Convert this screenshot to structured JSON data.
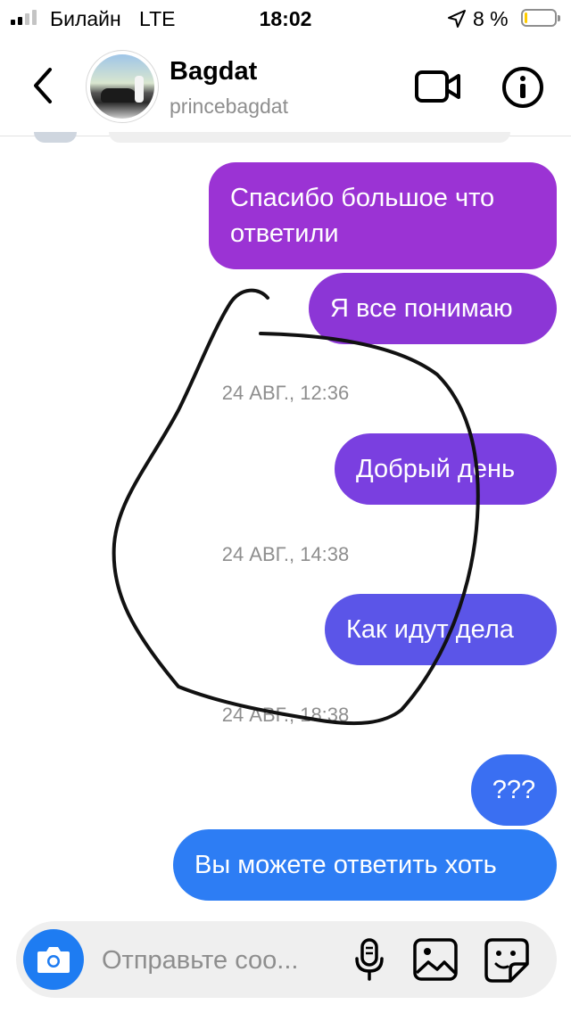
{
  "status_bar": {
    "carrier": "Билайн",
    "network": "LTE",
    "time": "18:02",
    "battery_percent": "8 %",
    "battery_level": 0.08,
    "battery_color": "#ffcc00",
    "signal_bars_active": 2,
    "icons": [
      "signal-icon",
      "location-arrow-icon",
      "battery-icon"
    ]
  },
  "header": {
    "name": "Bagdat",
    "username": "princebagdat",
    "icons": [
      "back-chevron-icon",
      "video-camera-icon",
      "info-icon"
    ]
  },
  "messages": [
    {
      "type": "sent",
      "text_lines": [
        "Спасибо большое что",
        "ответили"
      ],
      "color": "#9b33d4"
    },
    {
      "type": "sent",
      "text": "Я все понимаю",
      "color": "#8c36d6"
    },
    {
      "type": "timestamp",
      "text": "24 АВГ., 12:36"
    },
    {
      "type": "sent",
      "text": "Добрый день",
      "color": "#7a3fe0"
    },
    {
      "type": "timestamp",
      "text": "24 АВГ., 14:38"
    },
    {
      "type": "sent",
      "text": "Как идут дела",
      "color": "#5b55e8"
    },
    {
      "type": "timestamp",
      "text": "24 АВГ., 18:38"
    },
    {
      "type": "sent",
      "text": "???",
      "color": "#3a6ff2"
    },
    {
      "type": "sent",
      "text": "Вы можете ответить хоть",
      "color": "#2d7df4"
    }
  ],
  "composer": {
    "placeholder": "Отправьте соо...",
    "icons": [
      "camera-icon",
      "microphone-icon",
      "gallery-icon",
      "sticker-icon"
    ],
    "accent": "#1e7cf2"
  }
}
